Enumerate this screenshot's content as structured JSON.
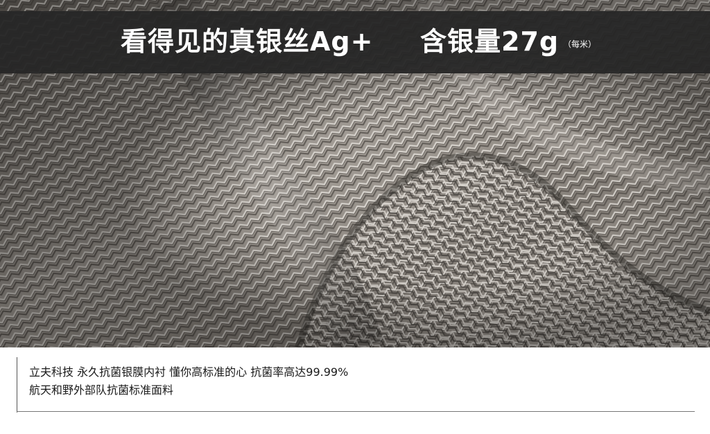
{
  "banner": {
    "title": "看得见的真银丝Ag+",
    "amount": "含银量27g",
    "unit": "（每米）"
  },
  "caption": {
    "line1": "立夫科技  永久抗菌银膜内衬  懂你高标准的心 抗菌率高达99.99%",
    "line2": "航天和野外部队抗菌标准面料"
  },
  "colors": {
    "banner_bg": "#262626",
    "fabric_base": "#8f8a84",
    "text_dark": "#1a1a1a"
  }
}
